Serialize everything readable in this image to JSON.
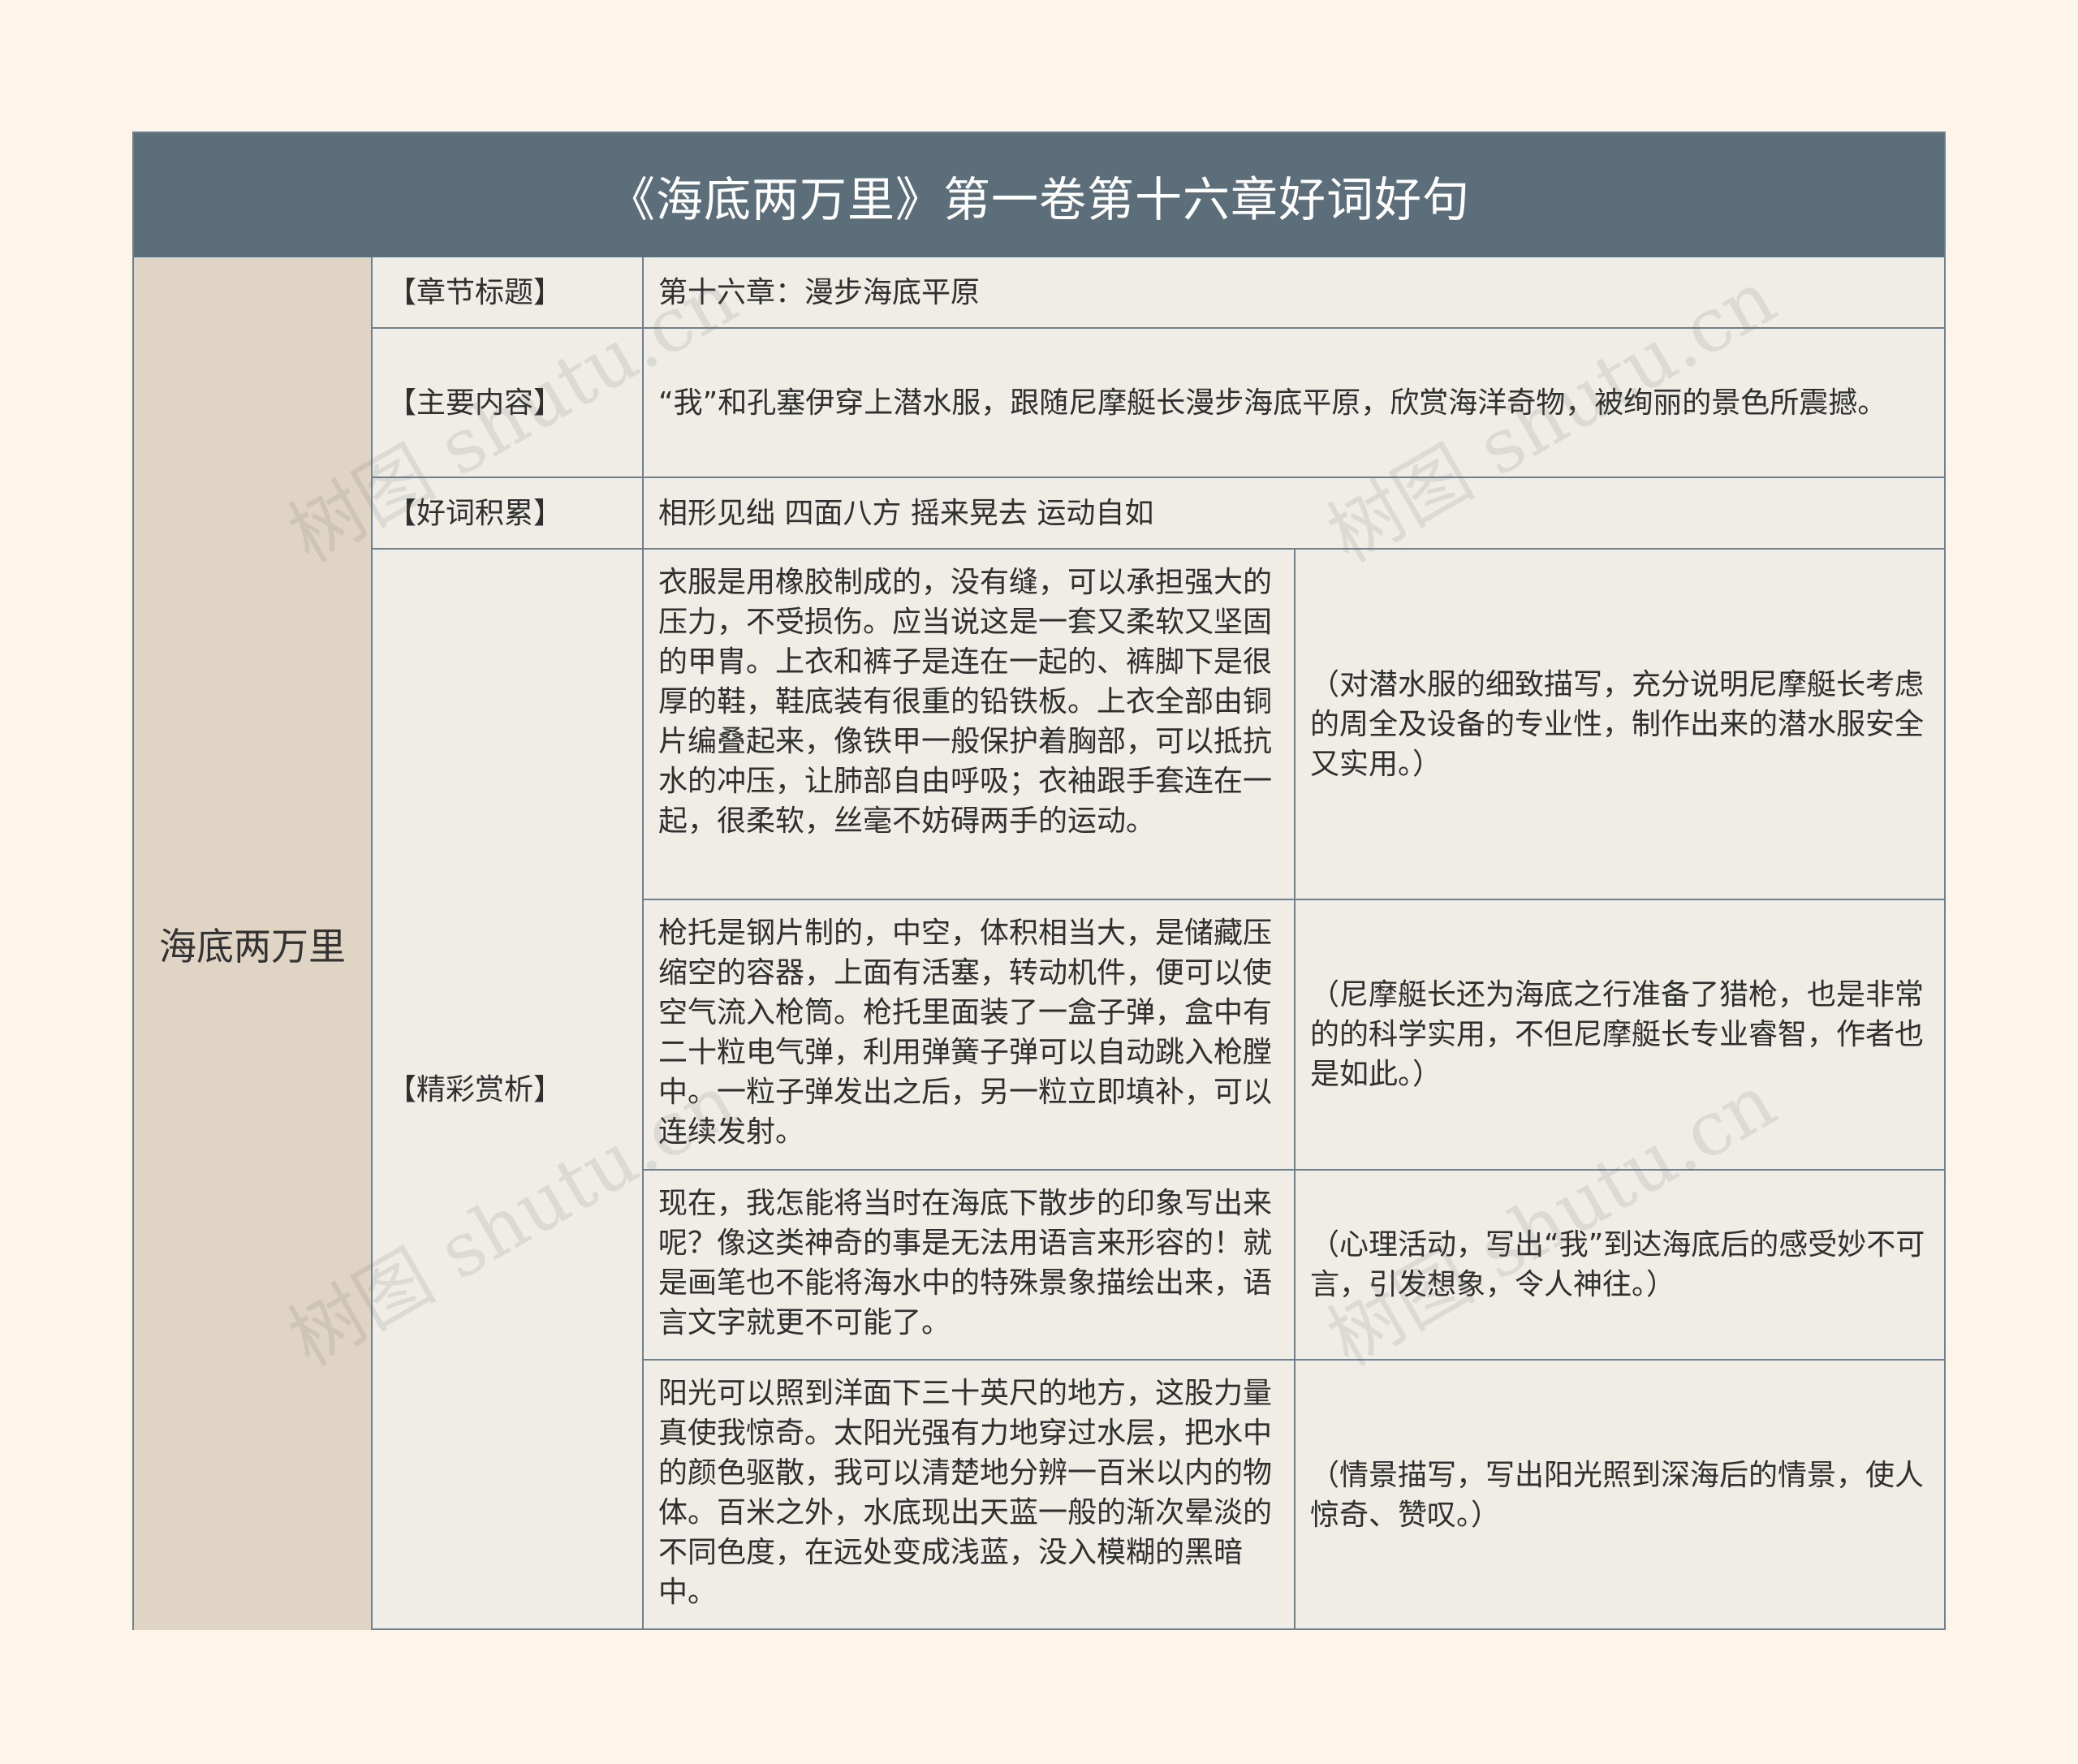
{
  "title": "《海底两万里》第一卷第十六章好词好句",
  "root": "海底两万里",
  "rows": {
    "chapter": {
      "label": "【章节标题】",
      "value": "第十六章：漫步海底平原"
    },
    "summary": {
      "label": "【主要内容】",
      "value": "“我”和孔塞伊穿上潜水服，跟随尼摩艇长漫步海底平原，欣赏海洋奇物，被绚丽的景色所震撼。"
    },
    "words": {
      "label": "【好词积累】",
      "value": "相形见绌 四面八方 摇来晃去 运动自如"
    },
    "analysis": {
      "label": "【精彩赏析】",
      "items": [
        {
          "quote": "衣服是用橡胶制成的，没有缝，可以承担强大的压力，不受损伤。应当说这是一套又柔软又坚固的甲胄。上衣和裤子是连在一起的、裤脚下是很厚的鞋，鞋底装有很重的铅铁板。上衣全部由铜片编叠起来，像铁甲一般保护着胸部，可以抵抗水的冲压，让肺部自由呼吸；衣袖跟手套连在一起，很柔软，丝毫不妨碍两手的运动。",
          "comment": "（对潜水服的细致描写，充分说明尼摩艇长考虑的周全及设备的专业性，制作出来的潜水服安全又实用。）"
        },
        {
          "quote": "枪托是钢片制的，中空，体积相当大，是储藏压缩空的容器，上面有活塞，转动机件，便可以使空气流入枪筒。枪托里面装了一盒子弹，盒中有二十粒电气弹，利用弹簧子弹可以自动跳入枪膛中。一粒子弹发出之后，另一粒立即填补，可以连续发射。",
          "comment": "（尼摩艇长还为海底之行准备了猎枪，也是非常的的科学实用，不但尼摩艇长专业睿智，作者也是如此。）"
        },
        {
          "quote": "现在，我怎能将当时在海底下散步的印象写出来呢？像这类神奇的事是无法用语言来形容的！就是画笔也不能将海水中的特殊景象描绘出来，语言文字就更不可能了。",
          "comment": "（心理活动，写出“我”到达海底后的感受妙不可言，引发想象，令人神往。）"
        },
        {
          "quote": "阳光可以照到洋面下三十英尺的地方，这股力量真使我惊奇。太阳光强有力地穿过水层，把水中的颜色驱散，我可以清楚地分辨一百米以内的物体。百米之外，水底现出天蓝一般的渐次晕淡的不同色度，在远处变成浅蓝，没入模糊的黑暗中。",
          "comment": "（情景描写，写出阳光照到深海后的情景，使人惊奇、赞叹。）"
        }
      ]
    }
  },
  "watermark": "树图 shutu.cn"
}
